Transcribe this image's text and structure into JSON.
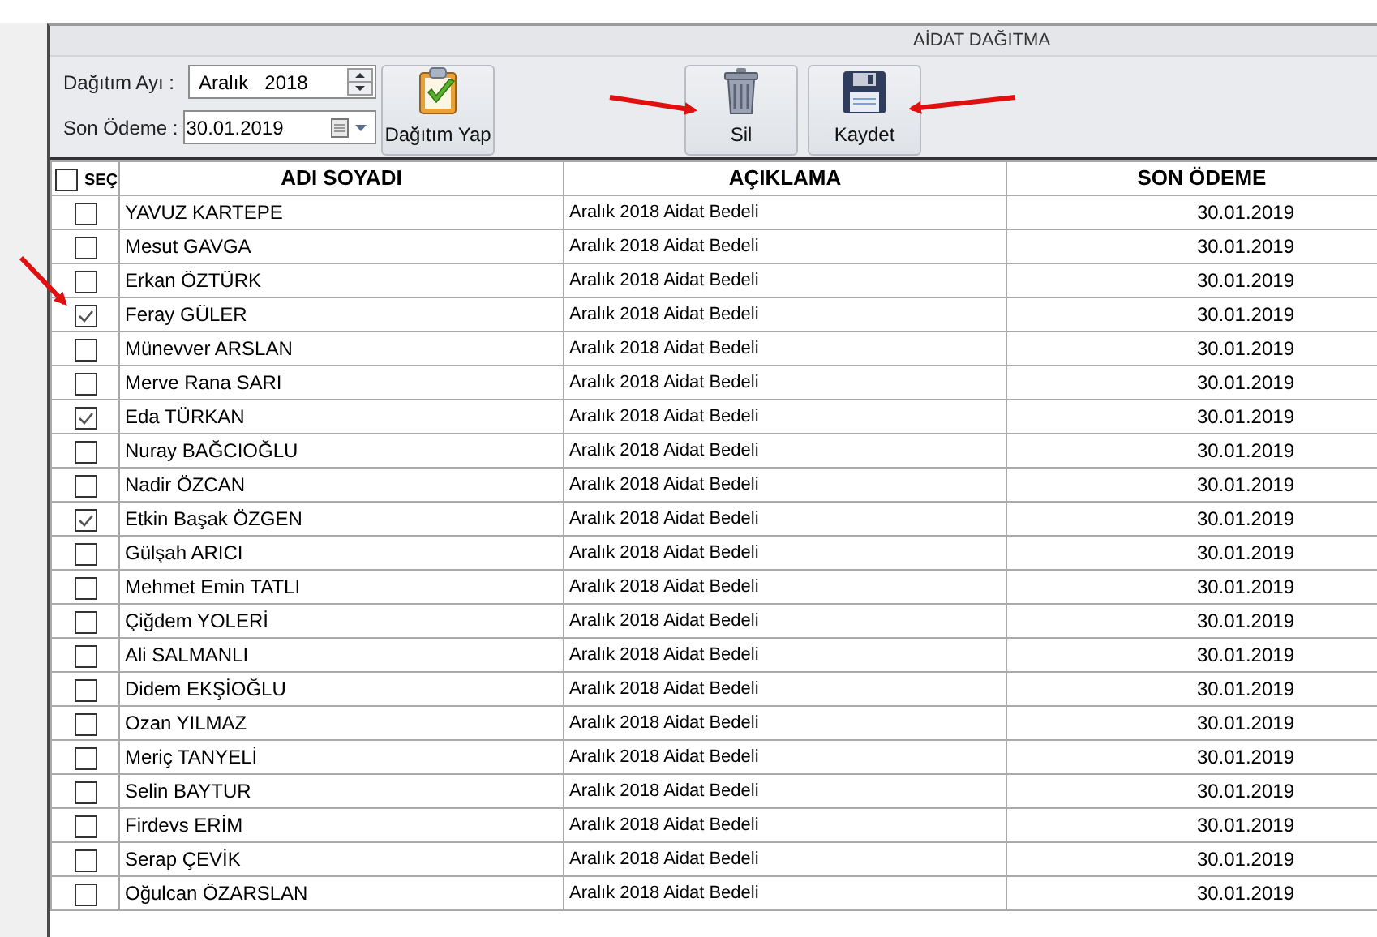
{
  "window": {
    "title": "AİDAT DAĞITMA"
  },
  "form": {
    "month_label": "Dağıtım Ayı :",
    "month_value": "Aralık   2018",
    "payment_label": "Son Ödeme :",
    "payment_value": "30.01.2019"
  },
  "buttons": [
    {
      "label": "Dağıtım Yap",
      "kind": "clipboard"
    },
    {
      "label": "Sil",
      "kind": "trash"
    },
    {
      "label": "Kaydet",
      "kind": "save"
    }
  ],
  "table": {
    "select_all": {
      "label": "SEÇ",
      "checked": false
    },
    "columns": [
      "ADI SOYADI",
      "AÇIKLAMA",
      "SON ÖDEME"
    ],
    "rows": [
      {
        "checked": false,
        "name": "YAVUZ KARTEPE",
        "description": "Aralık 2018 Aidat Bedeli",
        "last_payment": "30.01.2019"
      },
      {
        "checked": false,
        "name": "Mesut GAVGA",
        "description": "Aralık 2018 Aidat Bedeli",
        "last_payment": "30.01.2019"
      },
      {
        "checked": false,
        "name": "Erkan ÖZTÜRK",
        "description": "Aralık 2018 Aidat Bedeli",
        "last_payment": "30.01.2019"
      },
      {
        "checked": true,
        "name": "Feray GÜLER",
        "description": "Aralık 2018 Aidat Bedeli",
        "last_payment": "30.01.2019"
      },
      {
        "checked": false,
        "name": "Münevver ARSLAN",
        "description": "Aralık 2018 Aidat Bedeli",
        "last_payment": "30.01.2019"
      },
      {
        "checked": false,
        "name": "Merve Rana SARI",
        "description": "Aralık 2018 Aidat Bedeli",
        "last_payment": "30.01.2019"
      },
      {
        "checked": true,
        "name": "Eda TÜRKAN",
        "description": "Aralık 2018 Aidat Bedeli",
        "last_payment": "30.01.2019"
      },
      {
        "checked": false,
        "name": "Nuray BAĞCIOĞLU",
        "description": "Aralık 2018 Aidat Bedeli",
        "last_payment": "30.01.2019"
      },
      {
        "checked": false,
        "name": "Nadir ÖZCAN",
        "description": "Aralık 2018 Aidat Bedeli",
        "last_payment": "30.01.2019"
      },
      {
        "checked": true,
        "name": "Etkin Başak ÖZGEN",
        "description": "Aralık 2018 Aidat Bedeli",
        "last_payment": "30.01.2019"
      },
      {
        "checked": false,
        "name": "Gülşah ARICI",
        "description": "Aralık 2018 Aidat Bedeli",
        "last_payment": "30.01.2019"
      },
      {
        "checked": false,
        "name": "Mehmet Emin TATLI",
        "description": "Aralık 2018 Aidat Bedeli",
        "last_payment": "30.01.2019"
      },
      {
        "checked": false,
        "name": "Çiğdem YOLERİ",
        "description": "Aralık 2018 Aidat Bedeli",
        "last_payment": "30.01.2019"
      },
      {
        "checked": false,
        "name": "Ali SALMANLI",
        "description": "Aralık 2018 Aidat Bedeli",
        "last_payment": "30.01.2019"
      },
      {
        "checked": false,
        "name": "Didem EKŞİOĞLU",
        "description": "Aralık 2018 Aidat Bedeli",
        "last_payment": "30.01.2019"
      },
      {
        "checked": false,
        "name": "Ozan YILMAZ",
        "description": "Aralık 2018 Aidat Bedeli",
        "last_payment": "30.01.2019"
      },
      {
        "checked": false,
        "name": "Meriç TANYELİ",
        "description": "Aralık 2018 Aidat Bedeli",
        "last_payment": "30.01.2019"
      },
      {
        "checked": false,
        "name": "Selin BAYTUR",
        "description": "Aralık 2018 Aidat Bedeli",
        "last_payment": "30.01.2019"
      },
      {
        "checked": false,
        "name": "Firdevs ERİM",
        "description": "Aralık 2018 Aidat Bedeli",
        "last_payment": "30.01.2019"
      },
      {
        "checked": false,
        "name": "Serap ÇEVİK",
        "description": "Aralık 2018 Aidat Bedeli",
        "last_payment": "30.01.2019"
      },
      {
        "checked": false,
        "name": "Oğulcan ÖZARSLAN",
        "description": "Aralık 2018 Aidat Bedeli",
        "last_payment": "30.01.2019"
      }
    ]
  }
}
